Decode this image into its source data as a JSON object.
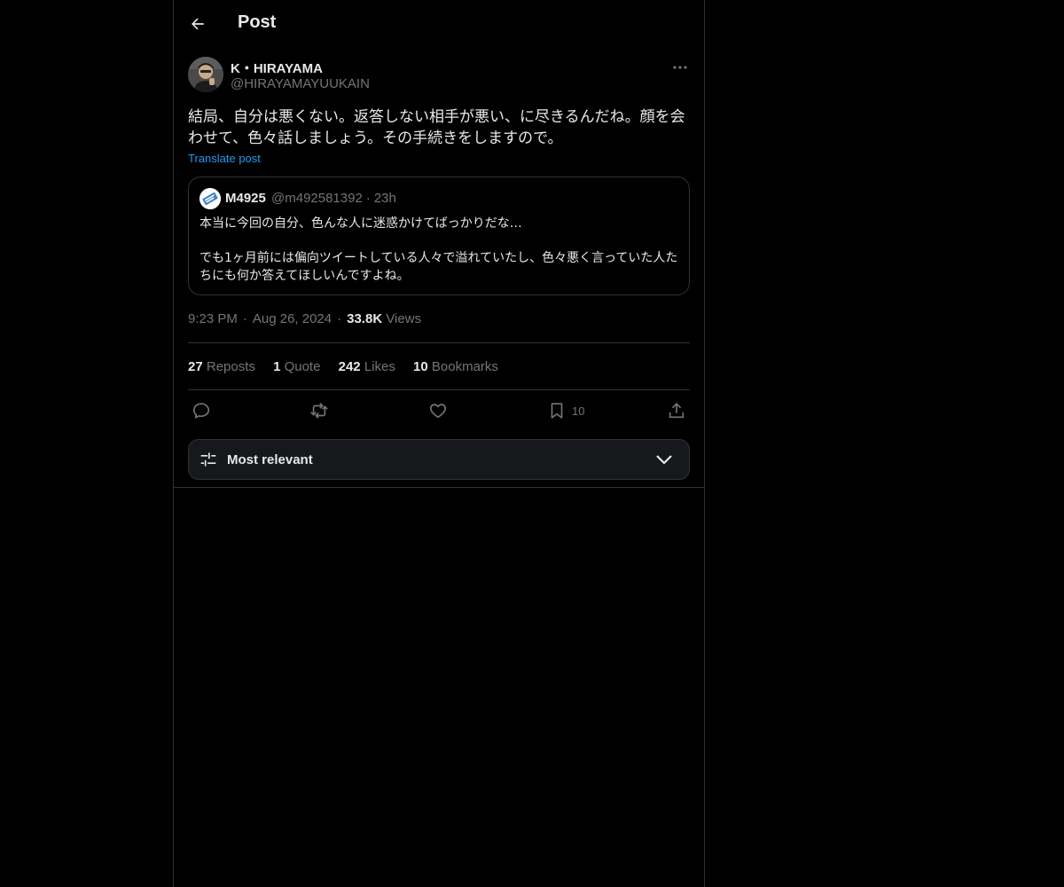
{
  "header": {
    "title": "Post"
  },
  "post": {
    "author_name": "K・HIRAYAMA",
    "author_handle": "@HIRAYAMAYUUKAIN",
    "text": "結局、自分は悪くない。返答しない相手が悪い、に尽きるんだね。顔を会わせて、色々話しましょう。その手続きをしますので。",
    "translate_label": "Translate post",
    "quote": {
      "name": "M4925",
      "handle": "@m492581392",
      "time": "23h",
      "line1": "本当に今回の自分、色んな人に迷惑かけてばっかりだな…",
      "line2": "でも1ヶ月前には偏向ツイートしている人々で溢れていたし、色々悪く言っていた人たちにも何か答えてほしいんですよね。"
    },
    "time": "9:23 PM",
    "date": "Aug 26, 2024",
    "views_count": "33.8K",
    "views_label": "Views"
  },
  "stats": {
    "reposts_count": "27",
    "reposts_label": "Reposts",
    "quotes_count": "1",
    "quotes_label": "Quote",
    "likes_count": "242",
    "likes_label": "Likes",
    "bookmarks_count": "10",
    "bookmarks_label": "Bookmarks"
  },
  "actions": {
    "reply_icon": "reply-icon",
    "repost_icon": "repost-icon",
    "like_icon": "heart-icon",
    "bookmark_icon": "bookmark-icon",
    "bookmark_count": "10",
    "share_icon": "share-icon"
  },
  "sort": {
    "label": "Most relevant"
  },
  "colors": {
    "background": "#000000",
    "text": "#e7e9ea",
    "secondary": "#71767b",
    "accent": "#1d9bf0",
    "border": "#2f3336"
  }
}
